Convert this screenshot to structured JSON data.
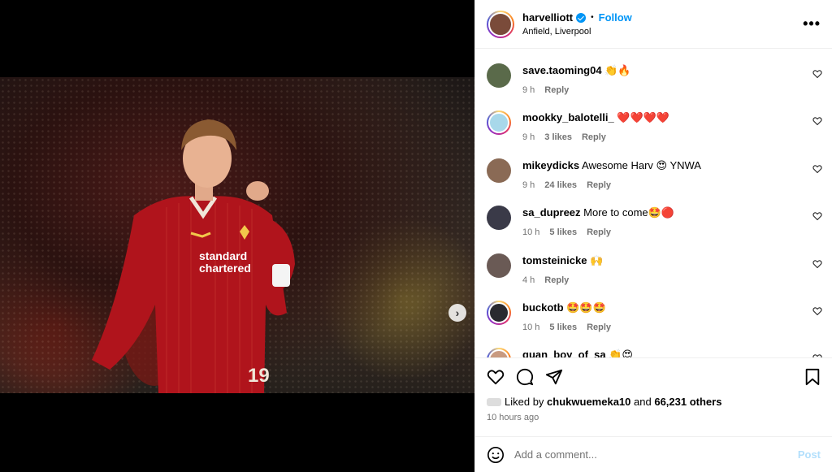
{
  "header": {
    "username": "harvelliott",
    "separator": "•",
    "follow_label": "Follow",
    "location": "Anfield, Liverpool",
    "more_label": "•••"
  },
  "media": {
    "next_label": "›",
    "carousel_position": 1,
    "carousel_count": 5
  },
  "comments": [
    {
      "user": "save.taoming04",
      "text": " 👏🔥",
      "time": "9 h",
      "likes": "",
      "reply": "Reply",
      "avatar_color": "#5a6a4a",
      "ring": false
    },
    {
      "user": "mookky_balotelli_",
      "text": " ❤️❤️❤️❤️",
      "time": "9 h",
      "likes": "3 likes",
      "reply": "Reply",
      "avatar_color": "#a8d8ea",
      "ring": true
    },
    {
      "user": "mikeydicks",
      "text": " Awesome Harv 😍 YNWA",
      "time": "9 h",
      "likes": "24 likes",
      "reply": "Reply",
      "avatar_color": "#8a6a55",
      "ring": false
    },
    {
      "user": "sa_dupreez",
      "text": " More to come🤩🔴",
      "time": "10 h",
      "likes": "5 likes",
      "reply": "Reply",
      "avatar_color": "#3a3a48",
      "ring": false
    },
    {
      "user": "tomsteinicke",
      "text": " 🙌",
      "time": "4 h",
      "likes": "",
      "reply": "Reply",
      "avatar_color": "#6a5a55",
      "ring": false
    },
    {
      "user": "buckotb",
      "text": " 🤩🤩🤩",
      "time": "10 h",
      "likes": "5 likes",
      "reply": "Reply",
      "avatar_color": "#2a2a30",
      "ring": true
    },
    {
      "user": "quan_boy_of_sa",
      "text": " 👏😍",
      "time": "",
      "likes": "",
      "reply": "",
      "avatar_color": "#c89a80",
      "ring": true
    }
  ],
  "likes": {
    "prefix": "Liked by ",
    "user": "chukwuemeka10",
    "middle": " and ",
    "count": "66,231 others"
  },
  "post_time": "10 hours ago",
  "add_comment": {
    "placeholder": "Add a comment...",
    "post_label": "Post"
  },
  "colors": {
    "accent": "#0095f6",
    "muted": "#737373",
    "post_disabled": "#b2dffc",
    "kit_red": "#b0141c"
  }
}
